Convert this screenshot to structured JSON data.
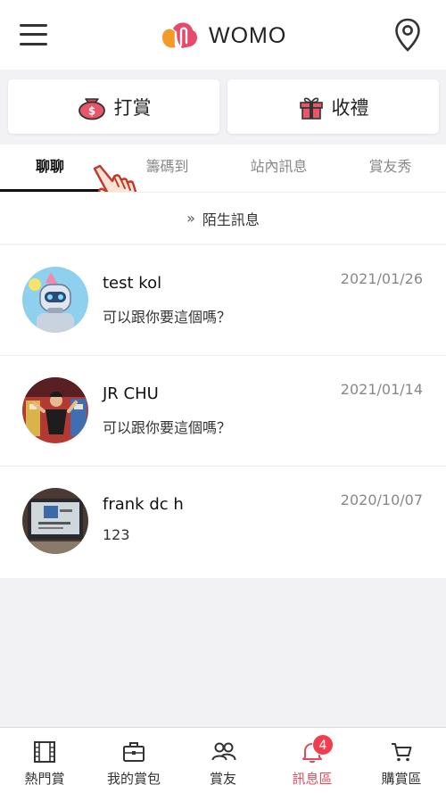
{
  "header": {
    "brand": "WOMO",
    "menu_icon": "menu-icon",
    "location_icon": "location-pin-icon"
  },
  "actions": {
    "tip_label": "打賞",
    "tip_icon": "money-bag-icon",
    "gift_label": "收禮",
    "gift_icon": "gift-icon"
  },
  "tabs": [
    {
      "label": "聊聊",
      "active": true
    },
    {
      "label": "籌碼到",
      "active": false
    },
    {
      "label": "站內訊息",
      "active": false
    },
    {
      "label": "賞友秀",
      "active": false
    }
  ],
  "stranger_messages": {
    "chevron": "»",
    "label": "陌生訊息"
  },
  "conversations": [
    {
      "name": "test kol",
      "message": "可以跟你要這個嗎？",
      "date": "2021/01/26"
    },
    {
      "name": "JR CHU",
      "message": "可以跟你要這個嗎？",
      "date": "2021/01/14"
    },
    {
      "name": "frank dc h",
      "message": "123",
      "date": "2020/10/07"
    }
  ],
  "bottom_nav": [
    {
      "label": "熱門賞",
      "icon": "film-icon",
      "active": false
    },
    {
      "label": "我的賞包",
      "icon": "briefcase-icon",
      "active": false
    },
    {
      "label": "賞友",
      "icon": "friends-icon",
      "active": false
    },
    {
      "label": "訊息區",
      "icon": "bell-icon",
      "active": true,
      "badge": "4"
    },
    {
      "label": "購賞區",
      "icon": "cart-icon",
      "active": false
    }
  ],
  "colors": {
    "accent": "#e24a5c",
    "badge": "#ef3f4e",
    "logo_orange": "#f39a2b",
    "logo_pink": "#e8496a"
  }
}
